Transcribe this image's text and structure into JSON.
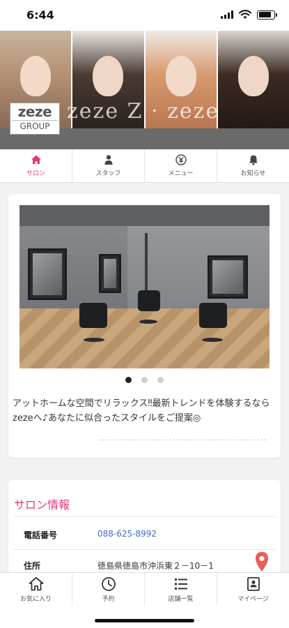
{
  "status_bar": {
    "time": "6:44"
  },
  "banner": {
    "brand_text": "zeze Z · zeze",
    "logo_top": "zeze",
    "logo_bottom": "GROUP"
  },
  "tabs": [
    {
      "label": "サロン",
      "icon": "home-icon",
      "active": true
    },
    {
      "label": "スタッフ",
      "icon": "person-icon",
      "active": false
    },
    {
      "label": "メニュー",
      "icon": "yen-icon",
      "active": false
    },
    {
      "label": "お知らせ",
      "icon": "bell-icon",
      "active": false
    }
  ],
  "gallery": {
    "description": "アットホームな空間でリラックス‼最新トレンドを体験するならzezeへ♪あなたに似合ったスタイルをご提案◎",
    "slide_count": 3,
    "active_slide": 1
  },
  "salon_info": {
    "title": "サロン情報",
    "rows": [
      {
        "label": "電話番号",
        "value": "088-625-8992"
      },
      {
        "label": "住所",
        "value": "徳島県徳島市沖浜東２－10－1"
      }
    ]
  },
  "bottom_nav": [
    {
      "label": "お気に入り",
      "icon": "home-icon"
    },
    {
      "label": "予約",
      "icon": "clock-icon"
    },
    {
      "label": "店舗一覧",
      "icon": "list-icon"
    },
    {
      "label": "マイページ",
      "icon": "profile-card-icon"
    }
  ],
  "colors": {
    "accent": "#e8357a",
    "link": "#3b6fc2"
  }
}
